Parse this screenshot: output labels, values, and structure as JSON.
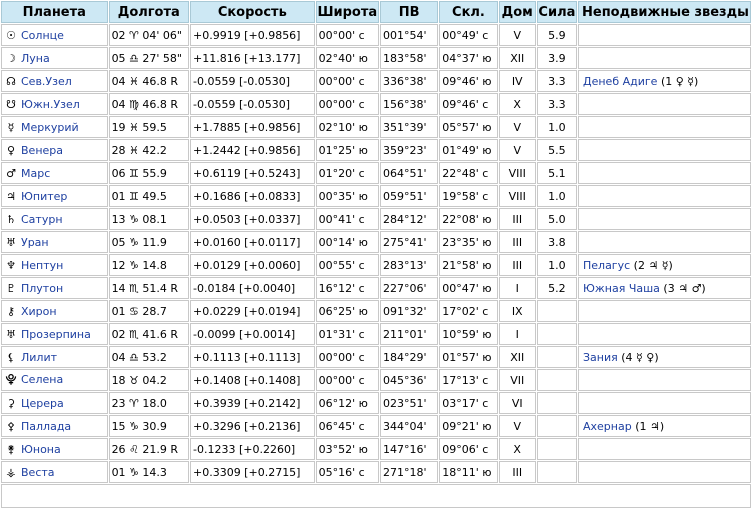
{
  "headers": {
    "planet": "Планета",
    "longitude": "Долгота",
    "speed": "Скорость",
    "latitude": "Широта",
    "ra": "ПВ",
    "decl": "Скл.",
    "house": "Дом",
    "power": "Сила",
    "stars": "Неподвижные звезды"
  },
  "rows": [
    {
      "glyph": "☉",
      "name": "Солнце",
      "lon": "02 ♈ 04' 06\"",
      "speed": "+0.9919  [+0.9856]",
      "lat": "00°00' с",
      "ra": "001°54'",
      "decl": "00°49' с",
      "house": "V",
      "power": "5.9",
      "star": "",
      "star_sym": ""
    },
    {
      "glyph": "☽",
      "name": "Луна",
      "lon": "05 ♎ 27' 58\"",
      "speed": "+11.816  [+13.177]",
      "lat": "02°40' ю",
      "ra": "183°58'",
      "decl": "04°37' ю",
      "house": "XII",
      "power": "3.9",
      "star": "",
      "star_sym": ""
    },
    {
      "glyph": "☊",
      "name": "Сев.Узел",
      "lon": "04 ♓ 46.8  R",
      "speed": "-0.0559  [-0.0530]",
      "lat": "00°00' с",
      "ra": "336°38'",
      "decl": "09°46' ю",
      "house": "IV",
      "power": "3.3",
      "star": "Денеб Адиге",
      "star_sym": "(1 ♀ ☿)"
    },
    {
      "glyph": "☋",
      "name": "Южн.Узел",
      "lon": "04 ♍ 46.8  R",
      "speed": "-0.0559  [-0.0530]",
      "lat": "00°00' с",
      "ra": "156°38'",
      "decl": "09°46' с",
      "house": "X",
      "power": "3.3",
      "star": "",
      "star_sym": ""
    },
    {
      "glyph": "☿",
      "name": "Меркурий",
      "lon": "19 ♓ 59.5",
      "speed": "+1.7885  [+0.9856]",
      "lat": "02°10' ю",
      "ra": "351°39'",
      "decl": "05°57' ю",
      "house": "V",
      "power": "1.0",
      "star": "",
      "star_sym": ""
    },
    {
      "glyph": "♀",
      "name": "Венера",
      "lon": "28 ♓ 42.2",
      "speed": "+1.2442  [+0.9856]",
      "lat": "01°25' ю",
      "ra": "359°23'",
      "decl": "01°49' ю",
      "house": "V",
      "power": "5.5",
      "star": "",
      "star_sym": ""
    },
    {
      "glyph": "♂",
      "name": "Марс",
      "lon": "06 ♊ 55.9",
      "speed": "+0.6119  [+0.5243]",
      "lat": "01°20' с",
      "ra": "064°51'",
      "decl": "22°48' с",
      "house": "VIII",
      "power": "5.1",
      "star": "",
      "star_sym": ""
    },
    {
      "glyph": "♃",
      "name": "Юпитер",
      "lon": "01 ♊ 49.5",
      "speed": "+0.1686  [+0.0833]",
      "lat": "00°35' ю",
      "ra": "059°51'",
      "decl": "19°58' с",
      "house": "VIII",
      "power": "1.0",
      "star": "",
      "star_sym": ""
    },
    {
      "glyph": "♄",
      "name": "Сатурн",
      "lon": "13 ♑ 08.1",
      "speed": "+0.0503  [+0.0337]",
      "lat": "00°41' с",
      "ra": "284°12'",
      "decl": "22°08' ю",
      "house": "III",
      "power": "5.0",
      "star": "",
      "star_sym": ""
    },
    {
      "glyph": "♅",
      "name": "Уран",
      "lon": "05 ♑ 11.9",
      "speed": "+0.0160  [+0.0117]",
      "lat": "00°14' ю",
      "ra": "275°41'",
      "decl": "23°35' ю",
      "house": "III",
      "power": "3.8",
      "star": "",
      "star_sym": ""
    },
    {
      "glyph": "♆",
      "name": "Нептун",
      "lon": "12 ♑ 14.8",
      "speed": "+0.0129  [+0.0060]",
      "lat": "00°55' с",
      "ra": "283°13'",
      "decl": "21°58' ю",
      "house": "III",
      "power": "1.0",
      "star": "Пелагус",
      "star_sym": "(2 ♃ ☿)"
    },
    {
      "glyph": "♇",
      "name": "Плутон",
      "lon": "14 ♏ 51.4  R",
      "speed": "-0.0184  [+0.0040]",
      "lat": "16°12' с",
      "ra": "227°06'",
      "decl": "00°47' ю",
      "house": "I",
      "power": "5.2",
      "star": "Южная Чаша",
      "star_sym": "(3 ♃ ♂)"
    },
    {
      "glyph": "⚷",
      "name": "Хирон",
      "lon": "01 ♋ 28.7",
      "speed": "+0.0229  [+0.0194]",
      "lat": "06°25' ю",
      "ra": "091°32'",
      "decl": "17°02' с",
      "house": "IX",
      "power": "",
      "star": "",
      "star_sym": ""
    },
    {
      "glyph": "♅",
      "name": "Прозерпина",
      "lon": "02 ♏ 41.6  R",
      "speed": "-0.0099  [+0.0014]",
      "lat": "01°31' с",
      "ra": "211°01'",
      "decl": "10°59' ю",
      "house": "I",
      "power": "",
      "star": "",
      "star_sym": ""
    },
    {
      "glyph": "⚸",
      "name": "Лилит",
      "lon": "04 ♎ 53.2",
      "speed": "+0.1113  [+0.1113]",
      "lat": "00°00' с",
      "ra": "184°29'",
      "decl": "01°57' ю",
      "house": "XII",
      "power": "",
      "star": "Зания",
      "star_sym": "(4 ☿ ♀)"
    },
    {
      "glyph": "⯓",
      "name": "Селена",
      "lon": "18 ♉ 04.2",
      "speed": "+0.1408  [+0.1408]",
      "lat": "00°00' с",
      "ra": "045°36'",
      "decl": "17°13' с",
      "house": "VII",
      "power": "",
      "star": "",
      "star_sym": ""
    },
    {
      "glyph": "⚳",
      "name": "Церера",
      "lon": "23 ♈ 18.0",
      "speed": "+0.3939  [+0.2142]",
      "lat": "06°12' ю",
      "ra": "023°51'",
      "decl": "03°17' с",
      "house": "VI",
      "power": "",
      "star": "",
      "star_sym": ""
    },
    {
      "glyph": "⚴",
      "name": "Паллада",
      "lon": "15 ♑ 30.9",
      "speed": "+0.3296  [+0.2136]",
      "lat": "06°45' с",
      "ra": "344°04'",
      "decl": "09°21' ю",
      "house": "V",
      "power": "",
      "star": "Ахернар",
      "star_sym": "(1 ♃)"
    },
    {
      "glyph": "⚵",
      "name": "Юнона",
      "lon": "26 ♌ 21.9  R",
      "speed": "-0.1233  [+0.2260]",
      "lat": "03°52' ю",
      "ra": "147°16'",
      "decl": "09°06' с",
      "house": "X",
      "power": "",
      "star": "",
      "star_sym": ""
    },
    {
      "glyph": "⚶",
      "name": "Веста",
      "lon": "01 ♑ 14.3",
      "speed": "+0.3309  [+0.2715]",
      "lat": "05°16' с",
      "ra": "271°18'",
      "decl": "18°11' ю",
      "house": "III",
      "power": "",
      "star": "",
      "star_sym": ""
    }
  ]
}
